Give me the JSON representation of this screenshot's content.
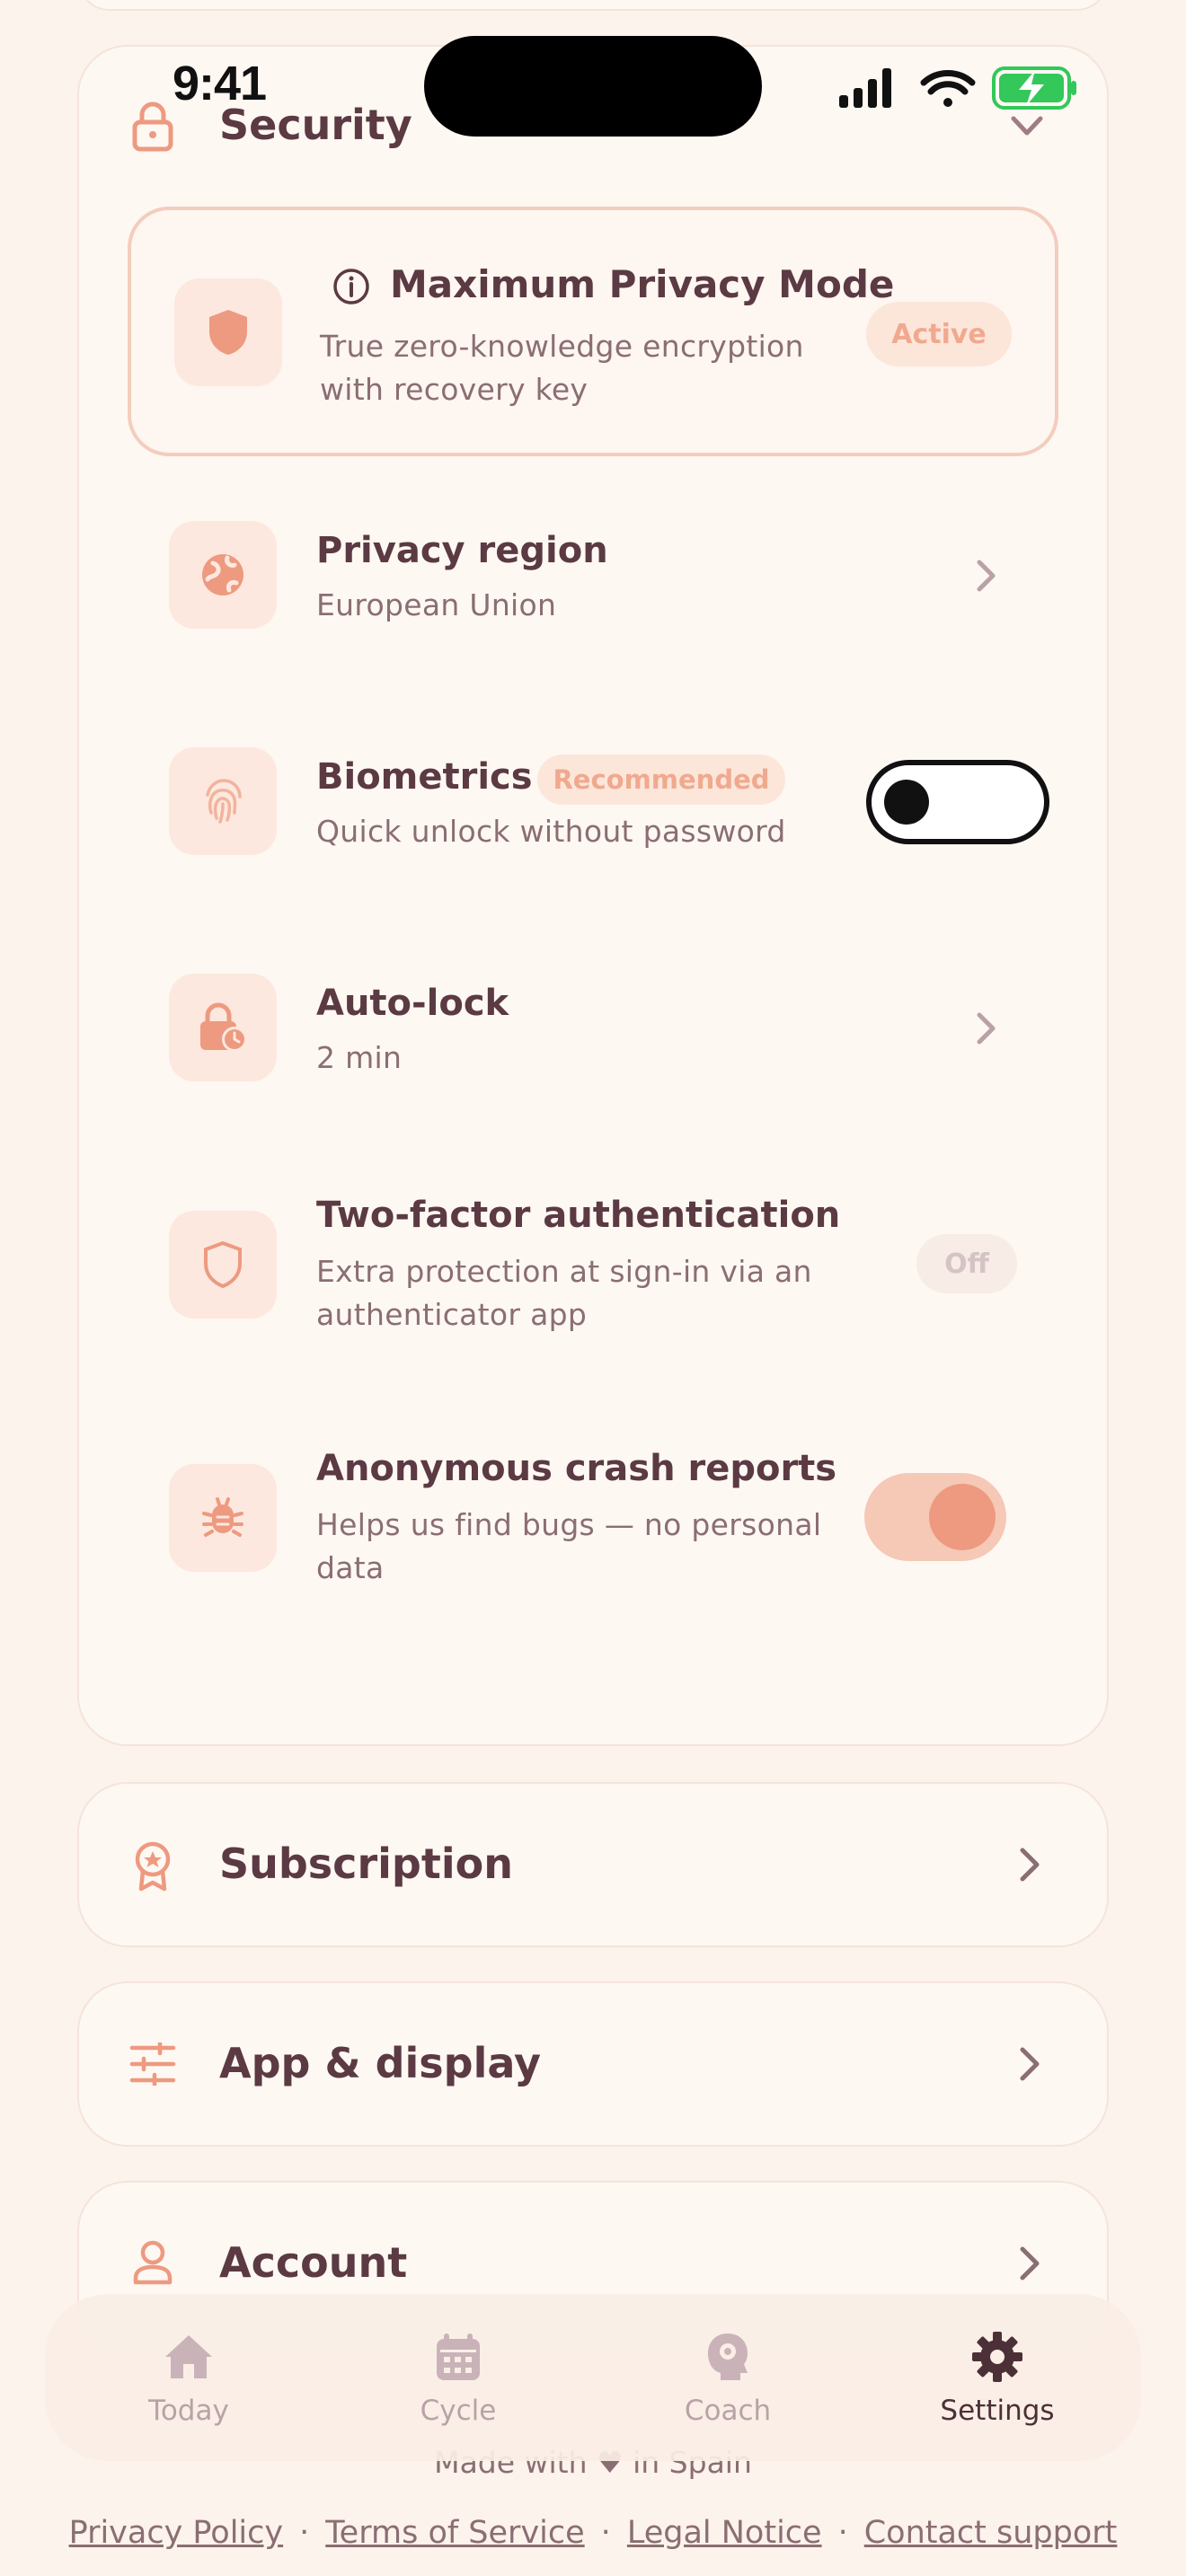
{
  "status_bar": {
    "time": "9:41"
  },
  "security": {
    "title": "Security",
    "privacy_mode": {
      "title": "Maximum Privacy Mode",
      "subtitle_line1": "True zero-knowledge encryption",
      "subtitle_line2": "with recovery key",
      "badge": "Active"
    },
    "rows": [
      {
        "title": "Privacy region",
        "subtitle": "European Union",
        "icon": "globe-icon"
      },
      {
        "title": "Biometrics",
        "badge": "Recommended",
        "subtitle": "Quick unlock without password",
        "icon": "fingerprint-icon",
        "toggle_on": false
      },
      {
        "title": "Auto-lock",
        "subtitle": "2 min",
        "icon": "lock-clock-icon"
      },
      {
        "title": "Two-factor authentication",
        "subtitle_line1": "Extra protection at sign-in via an",
        "subtitle_line2": "authenticator app",
        "badge": "Off",
        "icon": "shield-icon"
      },
      {
        "title": "Anonymous crash reports",
        "subtitle_line1": "Helps us find bugs — no personal",
        "subtitle_line2": "data",
        "icon": "bug-icon",
        "toggle_on": true
      }
    ]
  },
  "sections": [
    {
      "title": "Subscription",
      "icon": "badge-icon"
    },
    {
      "title": "App & display",
      "icon": "sliders-icon"
    },
    {
      "title": "Account",
      "icon": "person-icon"
    }
  ],
  "tabs": [
    {
      "label": "Today",
      "icon": "home-icon"
    },
    {
      "label": "Cycle",
      "icon": "calendar-icon"
    },
    {
      "label": "Coach",
      "icon": "coach-icon"
    },
    {
      "label": "Settings",
      "icon": "gear-icon",
      "active": true
    }
  ],
  "footer": {
    "made_with": "Made with ♥ in Spain",
    "links": [
      "Privacy Policy",
      "Terms of Service",
      "Legal Notice",
      "Contact support"
    ]
  },
  "colors": {
    "accent": "#ed9a80",
    "text": "#5b3a43",
    "background": "#fcf3ec"
  }
}
